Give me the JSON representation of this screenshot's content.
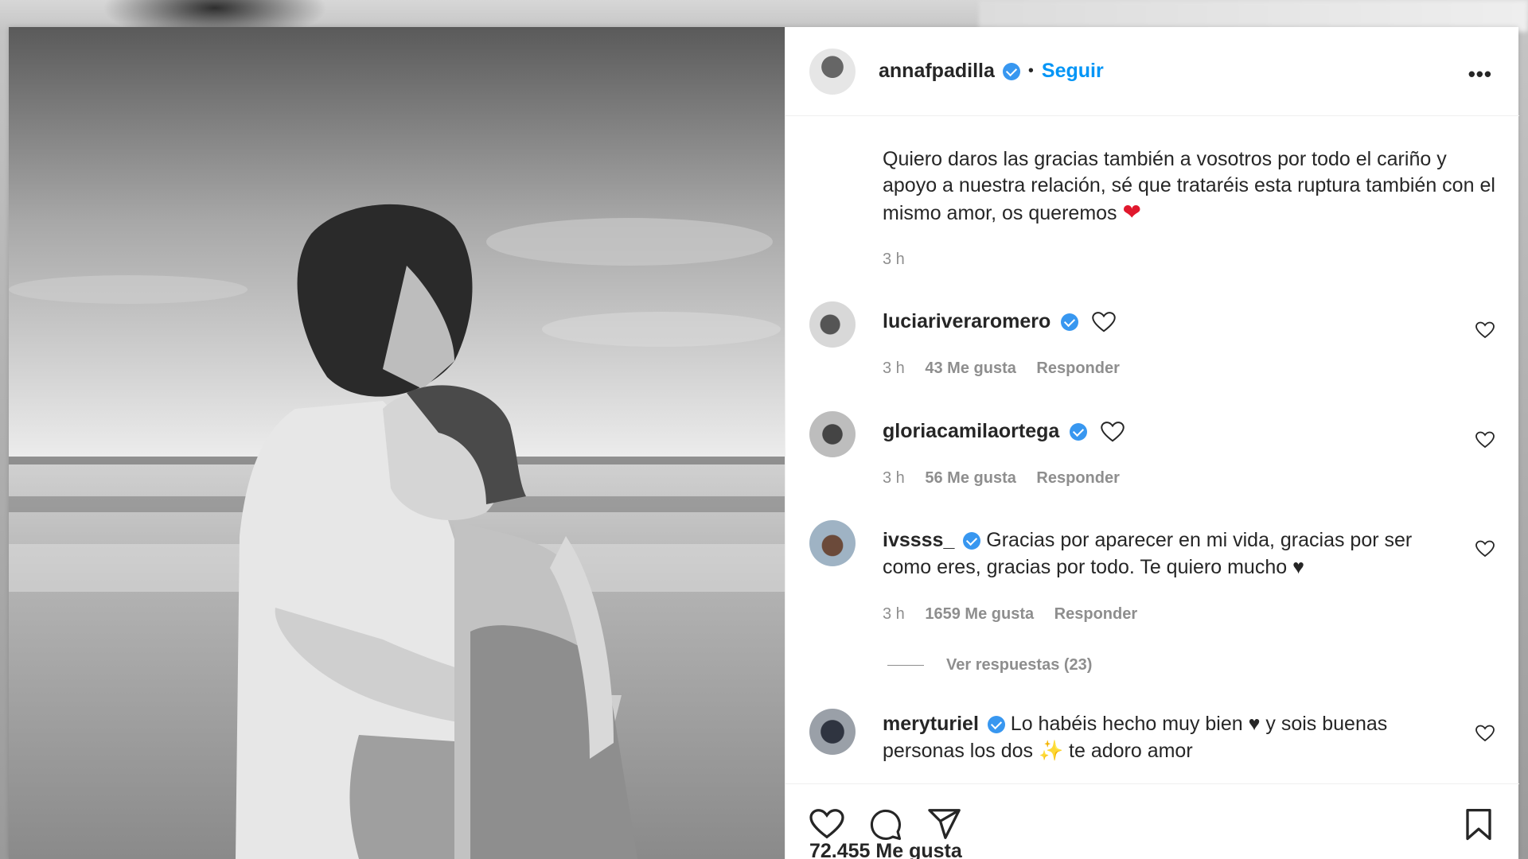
{
  "post": {
    "username": "annafpadilla",
    "separator": "•",
    "follow_label": "Seguir",
    "more_icon": "•••",
    "caption": "Quiero daros las gracias también a vosotros por todo el cariño y apoyo a nuestra relación, sé que trataréis esta ruptura también con el mismo amor, os queremos",
    "caption_emoji": "❤",
    "caption_time": "3 h",
    "likes": "72.455 Me gusta"
  },
  "comments": [
    {
      "username": "luciariveraromero",
      "text": "",
      "time": "3 h",
      "likes": "43 Me gusta",
      "reply": "Responder"
    },
    {
      "username": "gloriacamilaortega",
      "text": "",
      "time": "3 h",
      "likes": "56 Me gusta",
      "reply": "Responder"
    },
    {
      "username": "ivssss_",
      "text": "Gracias por aparecer en mi vida, gracias por ser como eres, gracias por todo. Te quiero mucho ♥",
      "time": "3 h",
      "likes": "1659 Me gusta",
      "reply": "Responder",
      "view_replies": "Ver respuestas (23)"
    },
    {
      "username": "meryturiel",
      "text": "Lo habéis hecho muy bien ♥ y sois buenas personas los dos ✨ te adoro amor"
    }
  ],
  "icons": [
    "verified-badge-icon",
    "more-options-icon",
    "heart-icon",
    "comment-icon",
    "share-icon",
    "bookmark-icon"
  ],
  "colors": {
    "accent": "#0095f6",
    "verified": "#3897f0",
    "heart": "#e0182d",
    "muted": "#8e8e8e",
    "text": "#262626"
  }
}
